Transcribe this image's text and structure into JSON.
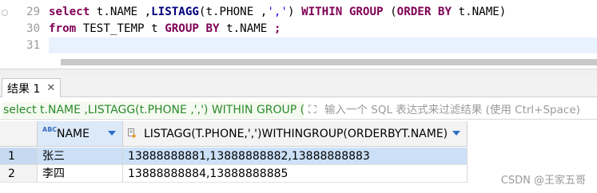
{
  "editor": {
    "lines": [
      {
        "number": "29"
      },
      {
        "number": "30"
      },
      {
        "number": "31"
      }
    ],
    "line29": {
      "kw_select": "select",
      "t1": " t.NAME ,",
      "kw_listagg": "LISTAGG",
      "t2": "(t.PHONE ,",
      "str": "','",
      "t3": ") ",
      "kw_within": "WITHIN GROUP",
      "t4": " (",
      "kw_orderby": "ORDER BY",
      "t5": " t.NAME)"
    },
    "line30": {
      "kw_from": "from",
      "t1": " TEST_TEMP t ",
      "kw_groupby": "GROUP BY",
      "t2": " t.NAME ",
      "semicolon": ";"
    }
  },
  "result_tab": {
    "label": "结果 1",
    "close_glyph": "✕"
  },
  "filter": {
    "sql_text": "select t.NAME ,LISTAGG(t.PHONE ,',') WITHIN GROUP (ORDER BY t.NAME) from TEST_TEMP t GROUP BY t.NAME",
    "icon_glyph": "⛶",
    "placeholder": "输入一个 SQL 表达式来过滤结果 (使用 Ctrl+Space)"
  },
  "grid": {
    "columns": [
      {
        "type_badge": "ABC",
        "label": "NAME"
      },
      {
        "label": "LISTAGG(T.PHONE,',')WITHINGROUP(ORDERBYT.NAME)"
      }
    ],
    "rows": [
      {
        "index": "1",
        "name": "张三",
        "listagg": "13888888881,13888888882,13888888883"
      },
      {
        "index": "2",
        "name": "李四",
        "listagg": "13888888884,13888888885"
      }
    ]
  },
  "watermark": "CSDN @王家五哥",
  "colors": {
    "keyword": "#7f0055",
    "string": "#2a00ff",
    "filter_text": "#2b8a2b",
    "selection": "#cce0f7",
    "sort_arrow": "#2d6fc7"
  }
}
